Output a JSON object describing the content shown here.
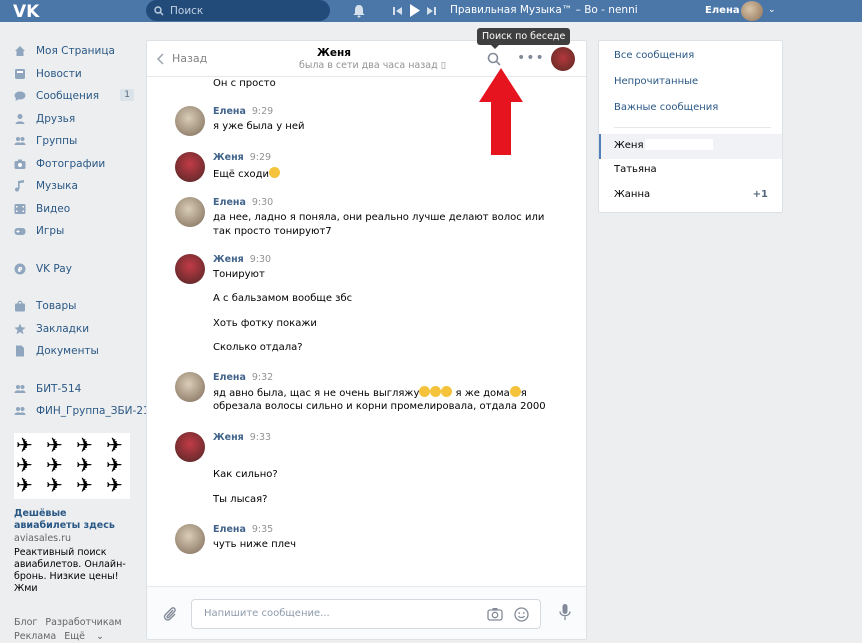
{
  "topbar": {
    "search_placeholder": "Поиск",
    "track": "Правильная Музыка™ – Bo - nenni",
    "username": "Елена"
  },
  "leftnav": {
    "items": [
      {
        "label": "Моя Страница",
        "icon": "home-icon"
      },
      {
        "label": "Новости",
        "icon": "news-icon"
      },
      {
        "label": "Сообщения",
        "icon": "messages-icon",
        "count": "1"
      },
      {
        "label": "Друзья",
        "icon": "friends-icon"
      },
      {
        "label": "Группы",
        "icon": "groups-icon"
      },
      {
        "label": "Фотографии",
        "icon": "camera-icon"
      },
      {
        "label": "Музыка",
        "icon": "music-icon"
      },
      {
        "label": "Видео",
        "icon": "video-icon"
      },
      {
        "label": "Игры",
        "icon": "games-icon"
      }
    ],
    "pay": "VK Pay",
    "items2": [
      {
        "label": "Товары",
        "icon": "bag-icon"
      },
      {
        "label": "Закладки",
        "icon": "star-icon"
      },
      {
        "label": "Документы",
        "icon": "document-icon"
      }
    ],
    "groups": [
      {
        "label": "БИТ-514",
        "icon": "group-icon"
      },
      {
        "label": "ФИН_Группа_ЗБИ-21",
        "icon": "group-icon"
      }
    ]
  },
  "ad": {
    "title": "Дешёвые авиабилеты здесь",
    "site": "aviasales.ru",
    "text": "Реактивный поиск авиабилетов. Онлайн-бронь. Низкие цены! Жми"
  },
  "footer": {
    "blog": "Блог",
    "dev": "Разработчикам",
    "ads": "Реклама",
    "more": "Ещё"
  },
  "chat": {
    "back": "Назад",
    "peer_name": "Женя",
    "peer_status": "была в сети два часа назад",
    "top_partial": "Он с                  просто",
    "messages": [
      {
        "author": "Елена",
        "time": "9:29",
        "lines": [
          "я уже была у ней"
        ]
      },
      {
        "author": "Женя",
        "time": "9:29",
        "lines": [
          "Ещё сходи"
        ]
      },
      {
        "author": "Елена",
        "time": "9:30",
        "lines": [
          "да нее, ладно я поняла, они реально лучше делают волос или",
          "так просто тонируют7"
        ]
      },
      {
        "author": "Женя",
        "time": "9:30",
        "lines": [
          "Тонируют",
          "А с бальзамом вообще збс",
          "Хоть фотку покажи",
          "Сколько отдала?"
        ]
      },
      {
        "author": "Елена",
        "time": "9:32",
        "lines": [
          "яд авно была, щас я не очень выгляжу",
          " я же дома",
          "обрезала волосы сильно и корни промелировала, отдала 2000"
        ]
      },
      {
        "author": "Женя",
        "time": "9:33",
        "lines": [
          "Как сильно?",
          "Ты лысая?"
        ]
      },
      {
        "author": "Елена",
        "time": "9:35",
        "lines": [
          "чуть ниже плеч"
        ]
      }
    ],
    "composer_placeholder": "Напишите сообщение...",
    "tooltip": "Поиск по беседе"
  },
  "right": {
    "all": "Все сообщения",
    "unread": "Непрочитанные",
    "important": "Важные сообщения",
    "convs": [
      {
        "name": "Женя"
      },
      {
        "name": "Татьяна"
      },
      {
        "name": "Жанна",
        "badge": "+1"
      }
    ]
  },
  "colors": {
    "topbar": "#4a76a8",
    "link": "#2a5885",
    "author": "#42648b",
    "arrow": "#e5141f"
  }
}
